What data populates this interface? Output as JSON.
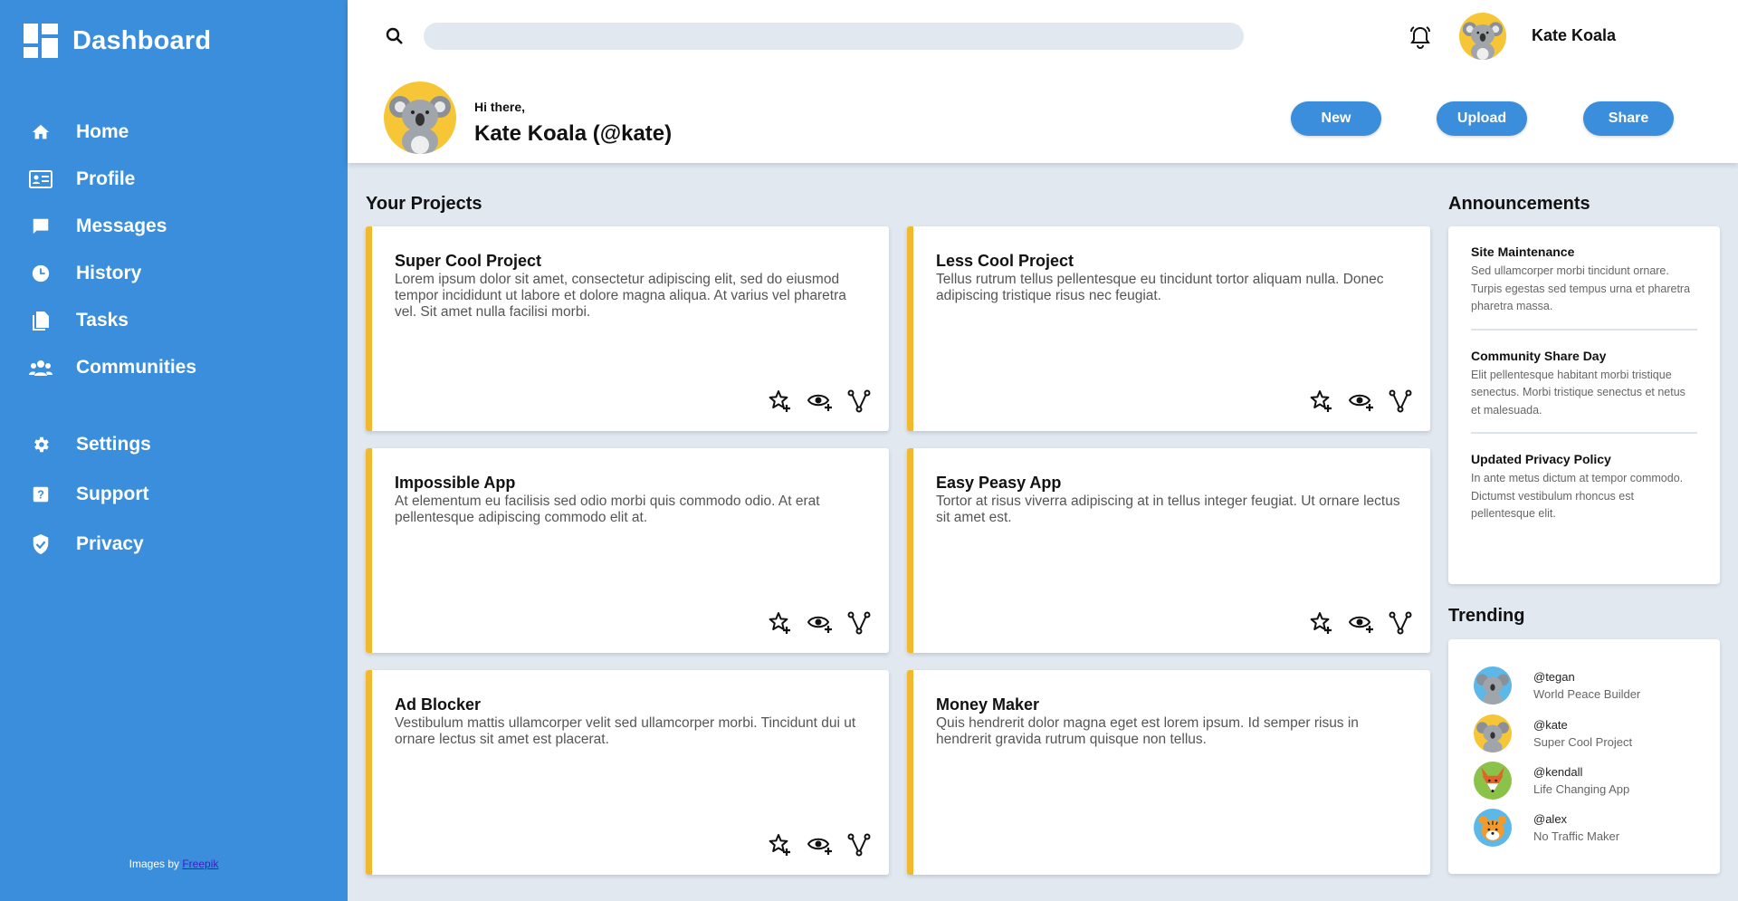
{
  "brand": {
    "title": "Dashboard"
  },
  "nav": {
    "primary": [
      {
        "label": "Home",
        "icon": "home-icon"
      },
      {
        "label": "Profile",
        "icon": "id-card-icon"
      },
      {
        "label": "Messages",
        "icon": "message-icon"
      },
      {
        "label": "History",
        "icon": "clock-icon"
      },
      {
        "label": "Tasks",
        "icon": "documents-icon"
      },
      {
        "label": "Communities",
        "icon": "group-icon"
      }
    ],
    "secondary": [
      {
        "label": "Settings",
        "icon": "gear-icon"
      },
      {
        "label": "Support",
        "icon": "help-icon"
      },
      {
        "label": "Privacy",
        "icon": "shield-icon"
      }
    ]
  },
  "credit": {
    "prefix": "Images by ",
    "link": "Freepik"
  },
  "header": {
    "search_placeholder": "",
    "user_name": "Kate Koala",
    "greeting": "Hi there,",
    "display_name": "Kate Koala (@kate)",
    "buttons": {
      "new": "New",
      "upload": "Upload",
      "share": "Share"
    }
  },
  "projects": {
    "title": "Your Projects",
    "items": [
      {
        "name": "Super Cool Project",
        "description": "Lorem ipsum dolor sit amet, consectetur adipiscing elit, sed do eiusmod tempor incididunt ut labore et dolore magna aliqua. At varius vel pharetra vel. Sit amet nulla facilisi morbi."
      },
      {
        "name": "Less Cool Project",
        "description": "Tellus rutrum tellus pellentesque eu tincidunt tortor aliquam nulla. Donec adipiscing tristique risus nec feugiat."
      },
      {
        "name": "Impossible App",
        "description": "At elementum eu facilisis sed odio morbi quis commodo odio. At erat pellentesque adipiscing commodo elit at."
      },
      {
        "name": "Easy Peasy App",
        "description": "Tortor at risus viverra adipiscing at in tellus integer feugiat. Ut ornare lectus sit amet est."
      },
      {
        "name": "Ad Blocker",
        "description": "Vestibulum mattis ullamcorper velit sed ullamcorper morbi. Tincidunt dui ut ornare lectus sit amet est placerat."
      },
      {
        "name": "Money Maker",
        "description": "Quis hendrerit dolor magna eget est lorem ipsum. Id semper risus in hendrerit gravida rutrum quisque non tellus."
      }
    ],
    "action_icons": [
      "star-add-icon",
      "watch-add-icon",
      "fork-icon"
    ]
  },
  "announcements": {
    "title": "Announcements",
    "items": [
      {
        "title": "Site Maintenance",
        "body": "Sed ullamcorper morbi tincidunt ornare. Turpis egestas sed tempus urna et pharetra pharetra massa."
      },
      {
        "title": "Community Share Day",
        "body": "Elit pellentesque habitant morbi tristique senectus. Morbi tristique senectus et netus et malesuada."
      },
      {
        "title": "Updated Privacy Policy",
        "body": "In ante metus dictum at tempor commodo. Dictumst vestibulum rhoncus est pellentesque elit."
      }
    ]
  },
  "trending": {
    "title": "Trending",
    "items": [
      {
        "handle": "@tegan",
        "project": "World Peace Builder",
        "avatar": "koala-avatar"
      },
      {
        "handle": "@kate",
        "project": "Super Cool Project",
        "avatar": "koala-avatar"
      },
      {
        "handle": "@kendall",
        "project": "Life Changing App",
        "avatar": "fox-avatar"
      },
      {
        "handle": "@alex",
        "project": "No Traffic Maker",
        "avatar": "tiger-avatar"
      }
    ]
  },
  "colors": {
    "sidebar": "#3b8edb",
    "accent_bar": "#f2b92e",
    "background": "#e2e8f0",
    "button": "#3b8edb"
  }
}
